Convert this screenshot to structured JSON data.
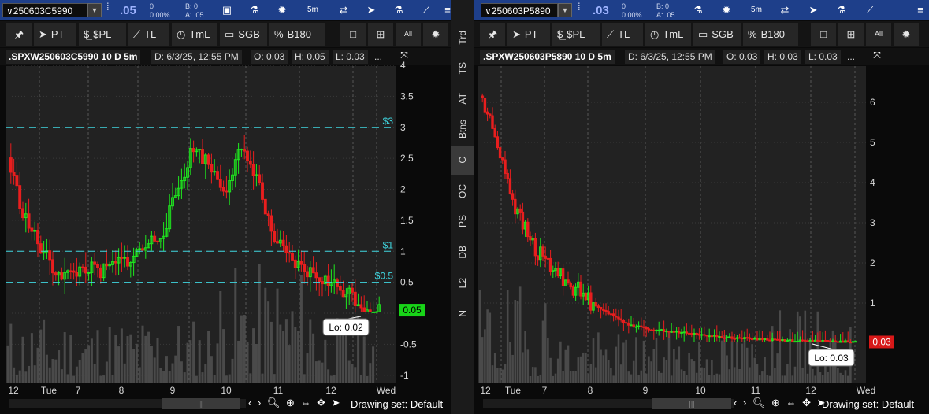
{
  "left": {
    "symbol": "∨250603C5990",
    "last": ".05",
    "change": "0",
    "pct": "0.00%",
    "bid": "B: 0",
    "ask": "A: .05",
    "timeframe": "5m",
    "chart_title": ".SPXW250603C5990 10 D 5m",
    "date": "D: 6/3/25, 12:55 PM",
    "open": "O: 0.03",
    "high": "H: 0.05",
    "low": "L: 0.03",
    "more": "...",
    "price_tag": "0.05",
    "lo_label": "Lo: 0.02",
    "y_ticks": [
      "4",
      "3.5",
      "3",
      "2.5",
      "2",
      "1.5",
      "1",
      "0.5",
      "0",
      "-0.5",
      "-1"
    ],
    "x_ticks": [
      "12",
      "Tue",
      "7",
      "8",
      "9",
      "10",
      "11",
      "12",
      "Wed"
    ],
    "alerts": [
      {
        "label": "$3",
        "price": 3
      },
      {
        "label": "$1",
        "price": 1
      },
      {
        "label": "$0.5",
        "price": 0.5
      }
    ],
    "draw_set": "Drawing set: Default"
  },
  "right": {
    "symbol": "∨250603P5890",
    "last": ".03",
    "change": "0",
    "pct": "0.00%",
    "bid": "B: 0",
    "ask": "A: .05",
    "timeframe": "5m",
    "chart_title": ".SPXW250603P5890 10 D 5m",
    "date": "D: 6/3/25, 12:55 PM",
    "open": "O: 0.03",
    "high": "H: 0.03",
    "low": "L: 0.03",
    "more": "...",
    "price_tag": "0.03",
    "lo_label": "Lo: 0.03",
    "y_ticks": [
      "6",
      "5",
      "4",
      "3",
      "2",
      "1"
    ],
    "x_ticks": [
      "12",
      "Tue",
      "7",
      "8",
      "9",
      "10",
      "11",
      "12",
      "Wed"
    ],
    "draw_set": "Drawing set: Default"
  },
  "tools": {
    "pt": "PT",
    "pl": "$PL",
    "tl": "TL",
    "tml": "TmL",
    "sgb": "SGB",
    "b180": "B180",
    "all": "All"
  },
  "side_tabs": [
    "Trd",
    "TS",
    "AT",
    "Btns",
    "C",
    "OC",
    "PS",
    "DB",
    "L2",
    "N"
  ],
  "active_side_tab": "C",
  "colors": {
    "up": "#1ee81e",
    "down": "#e81e1e",
    "alert": "#3fd6e0",
    "volume": "#4a4a4a",
    "topbar": "#1e3f8a"
  }
}
